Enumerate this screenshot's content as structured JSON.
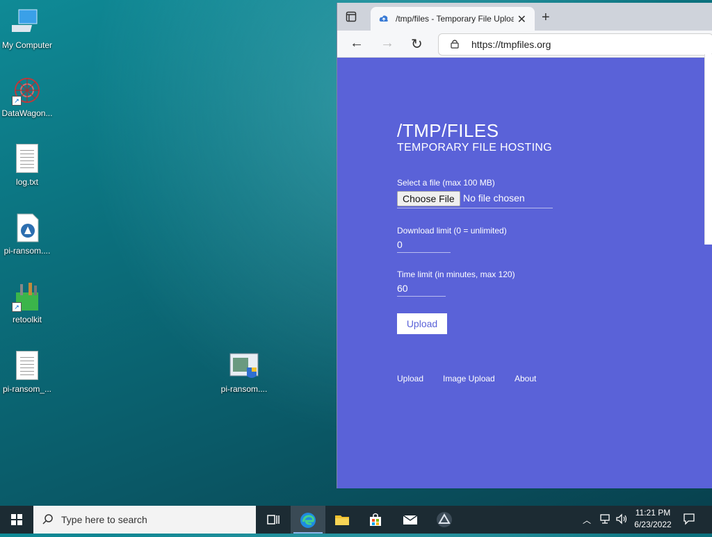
{
  "desktop": {
    "icons": [
      {
        "label": "My Computer",
        "icon": "computer-icon"
      },
      {
        "label": "DataWagon...",
        "icon": "datawagon-icon"
      },
      {
        "label": "log.txt",
        "icon": "text-file-icon"
      },
      {
        "label": "pi-ransom....",
        "icon": "installer-file-icon"
      },
      {
        "label": "retoolkit",
        "icon": "toolkit-icon"
      },
      {
        "label": "pi-ransom_...",
        "icon": "text-file-icon"
      },
      {
        "label": "pi-ransom....",
        "icon": "setup-exe-icon"
      }
    ]
  },
  "browser": {
    "tab_title": "/tmp/files - Temporary File Uploa",
    "url": "https://tmpfiles.org",
    "page": {
      "heading": "/TMP/FILES",
      "subheading": "TEMPORARY FILE HOSTING",
      "file_label": "Select a file (max 100 MB)",
      "file_button": "Choose File",
      "file_status": "No file chosen",
      "download_limit_label": "Download limit (0 = unlimited)",
      "download_limit_value": "0",
      "time_limit_label": "Time limit (in minutes, max 120)",
      "time_limit_value": "60",
      "upload_button": "Upload",
      "footer_links": [
        "Upload",
        "Image Upload",
        "About"
      ]
    }
  },
  "taskbar": {
    "search_placeholder": "Type here to search",
    "time": "11:21 PM",
    "date": "6/23/2022"
  },
  "colors": {
    "page_bg": "#5a62d8",
    "taskbar_bg": "#1c2b33"
  }
}
